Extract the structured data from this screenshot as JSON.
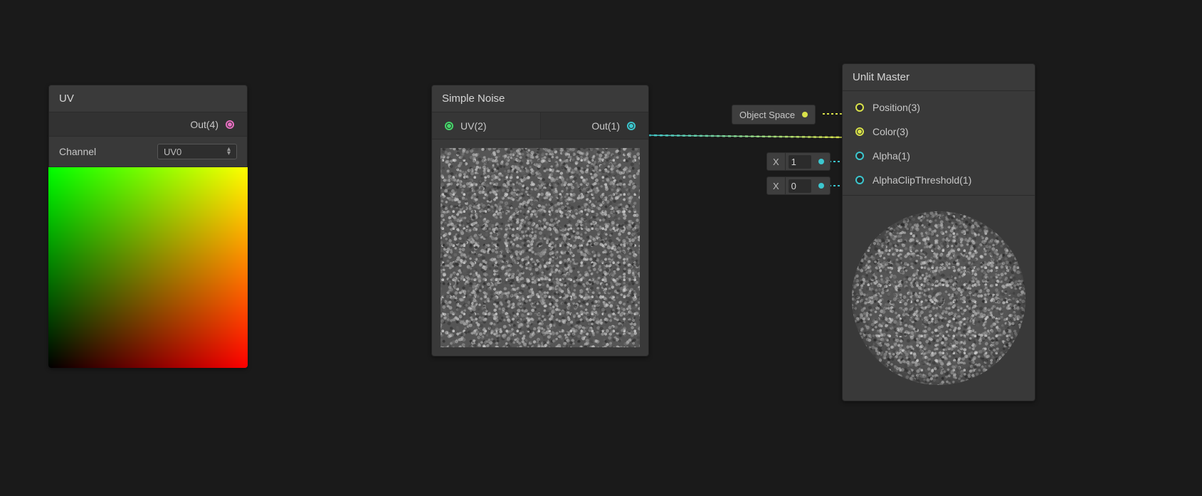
{
  "nodes": {
    "uv": {
      "title": "UV",
      "output_label": "Out(4)",
      "param_label": "Channel",
      "channel_value": "UV0"
    },
    "noise": {
      "title": "Simple Noise",
      "input_label": "UV(2)",
      "output_label": "Out(1)"
    },
    "master": {
      "title": "Unlit Master",
      "inputs": {
        "position": "Position(3)",
        "color": "Color(3)",
        "alpha": "Alpha(1)",
        "threshold": "AlphaClipThreshold(1)"
      }
    }
  },
  "pills": {
    "object_space": "Object Space",
    "x_label": "X",
    "alpha_value": "1",
    "threshold_value": "0"
  },
  "icons": {
    "dropdown_up": "▴",
    "dropdown_down": "▾"
  }
}
